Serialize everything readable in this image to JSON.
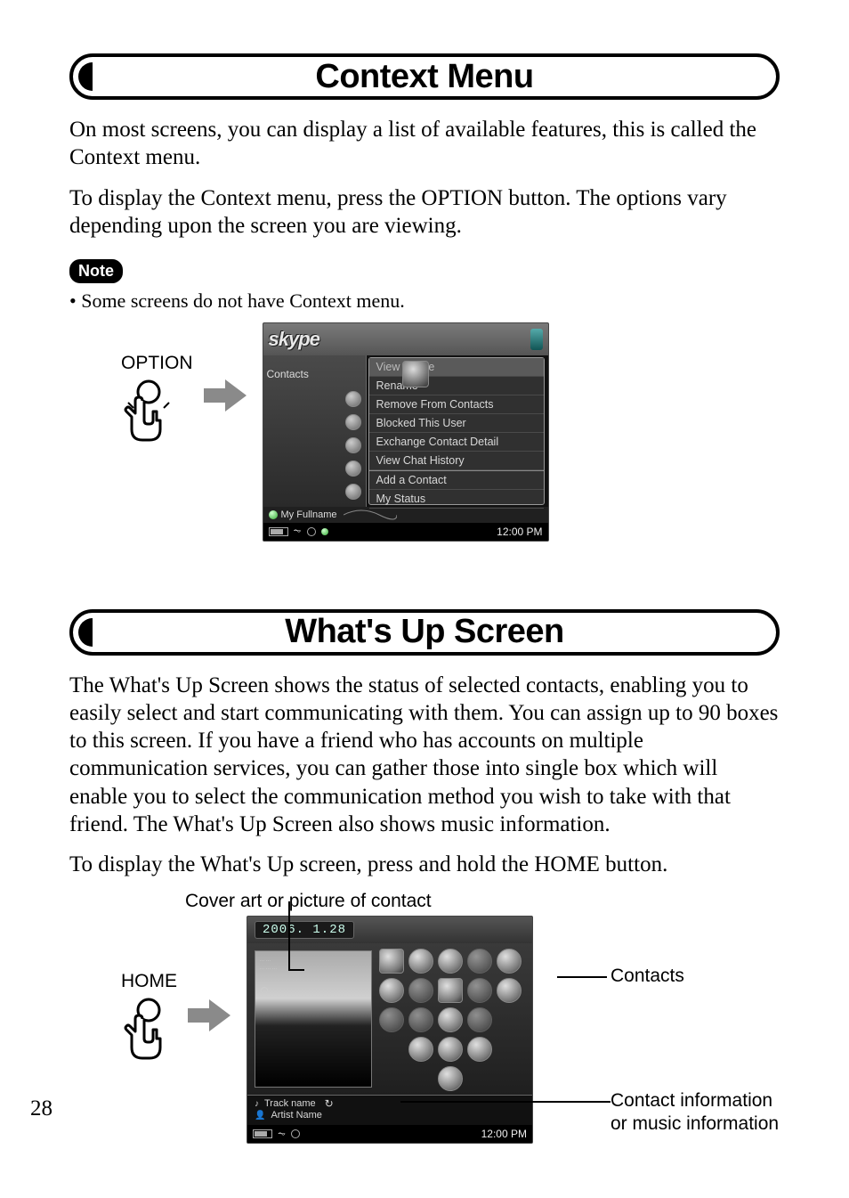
{
  "page_number": "28",
  "section1": {
    "title": "Context Menu",
    "para1": "On most screens, you can display a list of available features, this is called the Context menu.",
    "para2": "To display the Context menu, press the OPTION button. The options vary depending upon the screen you are viewing.",
    "note_badge": "Note",
    "note_bullet": "•  Some screens do not have Context menu.",
    "button_label": "OPTION",
    "device": {
      "logo": "skype",
      "left_label": "Contacts",
      "menu_items": [
        "View Profile",
        "Rename",
        "Remove From Contacts",
        "Blocked This User",
        "Exchange Contact Detail",
        "View Chat History",
        "Add a Contact",
        "My Status"
      ],
      "fullname_label": "My Fullname",
      "clock": "12:00 PM"
    }
  },
  "section2": {
    "title": "What's Up Screen",
    "para1": "The What's Up Screen shows the status of selected contacts, enabling you to easily select and start communicating with them. You can assign up to 90 boxes to this screen. If you have a friend who has accounts on multiple communication services, you can gather those into single box which will enable you to select the communication method you wish to take with that friend. The What's Up Screen also shows music information.",
    "para2": "To display the What's Up screen, press and hold the HOME button.",
    "button_label": "HOME",
    "caption_top": "Cover art or picture of contact",
    "callout_contacts": "Contacts",
    "callout_info1": "Contact information",
    "callout_info2": "or music information",
    "device": {
      "date": "2006. 1.28",
      "track": "Track name",
      "artist": "Artist Name",
      "clock": "12:00 PM"
    }
  }
}
